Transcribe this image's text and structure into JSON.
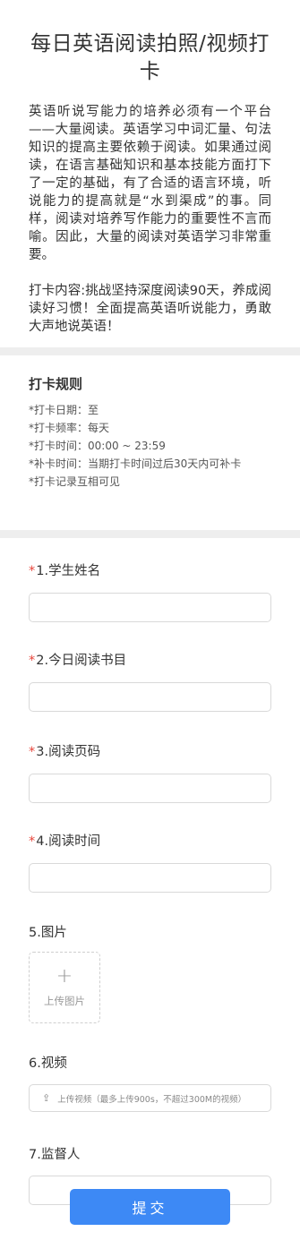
{
  "header": {
    "title": "每日英语阅读拍照/视频打卡",
    "intro_p1": "英语听说写能力的培养必须有一个平台——大量阅读。英语学习中词汇量、句法知识的提高主要依赖于阅读。如果通过阅读，在语言基础知识和基本技能方面打下了一定的基础，有了合适的语言环境，听说能力的提高就是“水到渠成”的事。同样，阅读对培养写作能力的重要性不言而喻。因此，大量的阅读对英语学习非常重要。",
    "intro_p2": "打卡内容:挑战坚持深度阅读90天，养成阅读好习惯！全面提高英语听说能力，勇敢大声地说英语！"
  },
  "rules": {
    "title": "打卡规则",
    "items": [
      "*打卡日期：至",
      "*打卡频率：每天",
      "*打卡时间：00:00 ~ 23:59",
      "*补卡时间：当期打卡时间过后30天内可补卡",
      "*打卡记录互相可见"
    ]
  },
  "form": {
    "required_mark": "*",
    "fields": [
      {
        "label": "1.学生姓名",
        "value": "",
        "placeholder": ""
      },
      {
        "label": "2.今日阅读书目",
        "value": "",
        "placeholder": ""
      },
      {
        "label": "3.阅读页码",
        "value": "",
        "placeholder": ""
      },
      {
        "label": "4.阅读时间",
        "value": "",
        "placeholder": ""
      }
    ],
    "image": {
      "label": "5.图片",
      "upload_text": "上传图片",
      "plus": "+"
    },
    "video": {
      "label": "6.视频",
      "upload_icon": "⇪",
      "upload_text": "上传视频（最多上传900s，不超过300M的视频）"
    },
    "supervisor": {
      "label": "7.监督人",
      "value": "",
      "placeholder": ""
    },
    "submit_label": "提交"
  }
}
